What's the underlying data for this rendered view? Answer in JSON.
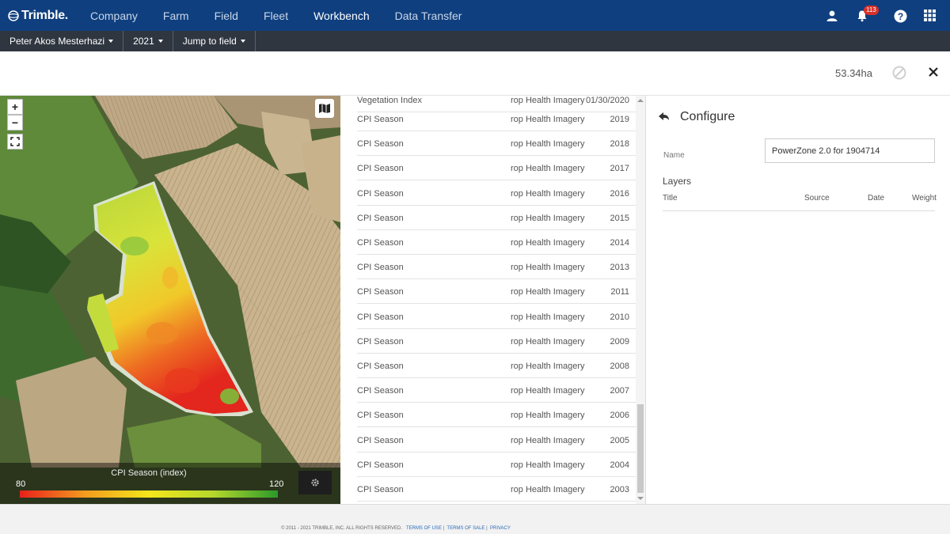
{
  "nav": {
    "brand": "Trimble.",
    "items": [
      "Company",
      "Farm",
      "Field",
      "Fleet",
      "Workbench",
      "Data Transfer"
    ],
    "active": "Workbench",
    "notification_count": "113"
  },
  "subnav": {
    "user": "Peter Akos Mesterhazi",
    "year": "2021",
    "jump": "Jump to field"
  },
  "toolbar": {
    "area": "53.34ha"
  },
  "map": {
    "zoom_in": "+",
    "zoom_out": "−",
    "legend_title": "CPI Season (index)",
    "legend_min": "80",
    "legend_max": "120",
    "legend_gradient": [
      "#e8201c",
      "#f49a1e",
      "#f4e61c",
      "#b5d82c",
      "#2a9a2a"
    ]
  },
  "layers_list": {
    "partial_row": {
      "title": "Vegetation Index",
      "source": "rop Health Imagery",
      "date": "01/30/2020"
    },
    "rows": [
      {
        "title": "CPI Season",
        "source": "rop Health Imagery",
        "date": "2019"
      },
      {
        "title": "CPI Season",
        "source": "rop Health Imagery",
        "date": "2018"
      },
      {
        "title": "CPI Season",
        "source": "rop Health Imagery",
        "date": "2017"
      },
      {
        "title": "CPI Season",
        "source": "rop Health Imagery",
        "date": "2016"
      },
      {
        "title": "CPI Season",
        "source": "rop Health Imagery",
        "date": "2015"
      },
      {
        "title": "CPI Season",
        "source": "rop Health Imagery",
        "date": "2014"
      },
      {
        "title": "CPI Season",
        "source": "rop Health Imagery",
        "date": "2013"
      },
      {
        "title": "CPI Season",
        "source": "rop Health Imagery",
        "date": "2011"
      },
      {
        "title": "CPI Season",
        "source": "rop Health Imagery",
        "date": "2010"
      },
      {
        "title": "CPI Season",
        "source": "rop Health Imagery",
        "date": "2009"
      },
      {
        "title": "CPI Season",
        "source": "rop Health Imagery",
        "date": "2008"
      },
      {
        "title": "CPI Season",
        "source": "rop Health Imagery",
        "date": "2007"
      },
      {
        "title": "CPI Season",
        "source": "rop Health Imagery",
        "date": "2006"
      },
      {
        "title": "CPI Season",
        "source": "rop Health Imagery",
        "date": "2005"
      },
      {
        "title": "CPI Season",
        "source": "rop Health Imagery",
        "date": "2004"
      },
      {
        "title": "CPI Season",
        "source": "rop Health Imagery",
        "date": "2003"
      }
    ]
  },
  "configure": {
    "title": "Configure",
    "name_label": "Name",
    "name_value": "PowerZone 2.0 for 1904714",
    "layers_label": "Layers",
    "columns": {
      "title": "Title",
      "source": "Source",
      "date": "Date",
      "weight": "Weight"
    }
  },
  "footer": {
    "copyright": "© 2011 - 2021 TRIMBLE, INC. ALL RIGHTS RESERVED.",
    "terms_of_use": "TERMS OF USE",
    "terms_of_sale": "TERMS OF SALE",
    "privacy": "PRIVACY"
  }
}
